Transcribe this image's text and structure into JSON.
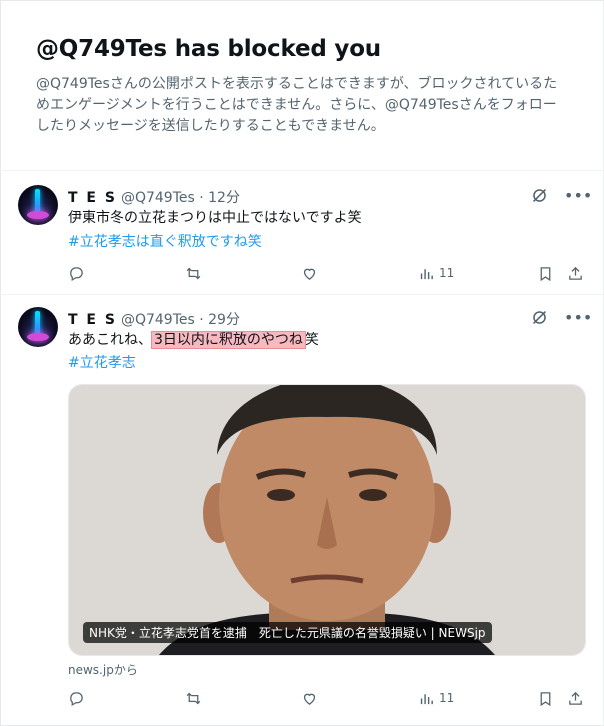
{
  "blocked": {
    "title": "@Q749Tes has blocked you",
    "description": "@Q749Tesさんの公開ポストを表示することはできますが、ブロックされているためエンゲージメントを行うことはできません。さらに、@Q749Tesさんをフォローしたりメッセージを送信したりすることもできません。"
  },
  "tweets": [
    {
      "name": "T E S",
      "handle": "@Q749Tes",
      "time": "· 12分",
      "text": "伊東市冬の立花まつりは中止ではないですよ笑",
      "hashtag": "#立花孝志は直ぐ釈放ですね笑",
      "views": "11"
    },
    {
      "name": "T E S",
      "handle": "@Q749Tes",
      "time": "· 29分",
      "text_before": "ああこれね、",
      "text_highlight": "3日以内に釈放のやつね",
      "text_after": "笑",
      "hashtag": "#立花孝志",
      "views": "11",
      "card": {
        "caption": "NHK党・立花孝志党首を逮捕　死亡した元県議の名誉毀損疑い | NEWSjp",
        "source": "news.jpから"
      }
    }
  ],
  "icons": [
    "reply-icon",
    "repost-icon",
    "like-icon",
    "views-icon",
    "bookmark-icon",
    "share-icon",
    "grok-icon",
    "more-icon"
  ]
}
